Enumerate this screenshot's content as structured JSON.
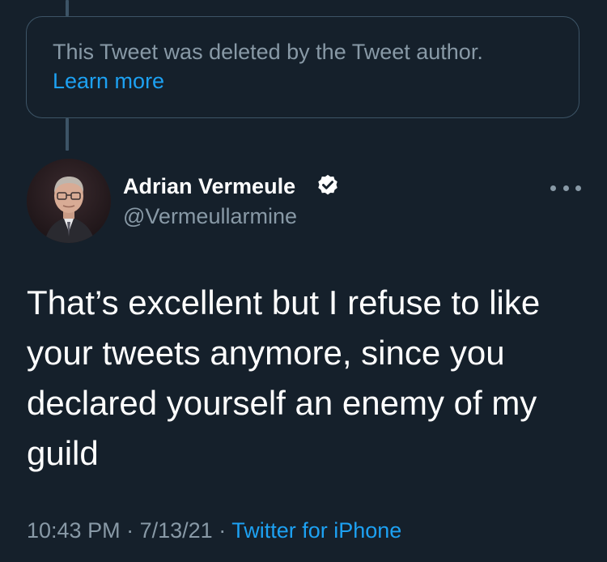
{
  "deleted_notice": {
    "text": "This Tweet was deleted by the Tweet author.",
    "link_label": "Learn more"
  },
  "tweet": {
    "author_name": "Adrian Vermeule",
    "author_handle": "@Vermeullarmine",
    "verified": true,
    "text": "That’s excellent but I refuse to like\nyour tweets anymore, since you\ndeclared yourself an enemy of my\nguild",
    "time": "10:43 PM",
    "separator": "·",
    "date": "7/13/21",
    "source": "Twitter for iPhone"
  },
  "colors": {
    "background": "#15202b",
    "accent": "#1da1f2",
    "secondary_text": "#8899a6",
    "border": "#3d5466"
  },
  "icons": {
    "verified": "verified-badge-icon",
    "more": "more-options-icon"
  }
}
